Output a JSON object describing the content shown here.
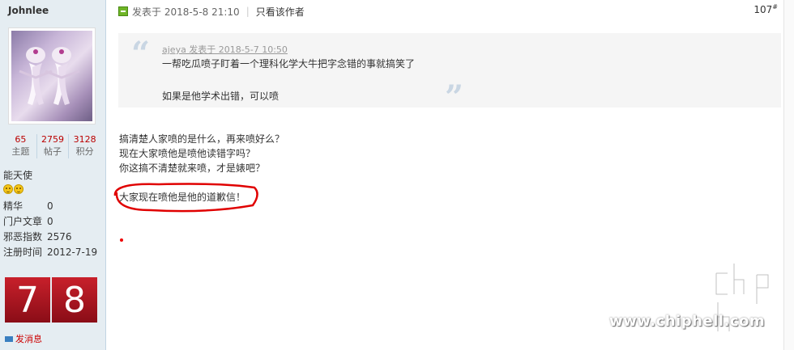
{
  "sidebar": {
    "username": "Johnlee",
    "stats": [
      {
        "value": "65",
        "label": "主题"
      },
      {
        "value": "2759",
        "label": "帖子"
      },
      {
        "value": "3128",
        "label": "积分"
      }
    ],
    "rank": "能天使",
    "info": [
      {
        "label": "精华",
        "value": "0"
      },
      {
        "label": "门户文章",
        "value": "0"
      },
      {
        "label": "邪恶指数",
        "value": "2576"
      },
      {
        "label": "注册时间",
        "value": "2012-7-19"
      }
    ],
    "digits": [
      "7",
      "8"
    ],
    "pm_label": "发消息"
  },
  "post": {
    "posted_text": "发表于 2018-5-8 21:10",
    "only_author": "只看该作者",
    "floor": "107",
    "floor_mark": "#",
    "quote": {
      "author_line": "ajeya 发表于 2018-5-7 10:50",
      "line1": "一帮吃瓜喷子盯着一个理科化学大牛把字念错的事就搞笑了",
      "line2": "如果是他学术出错，可以喷"
    },
    "body_lines": [
      "搞清楚人家喷的是什么，再来喷好么？",
      "现在大家喷他是喷他读错字吗？",
      "你这搞不清楚就来喷，才是婊吧？"
    ],
    "highlight": "大家现在喷他是他的道歉信！",
    "annotation_color": "#e00000"
  },
  "watermark": {
    "url": "www.chiphell.com"
  }
}
